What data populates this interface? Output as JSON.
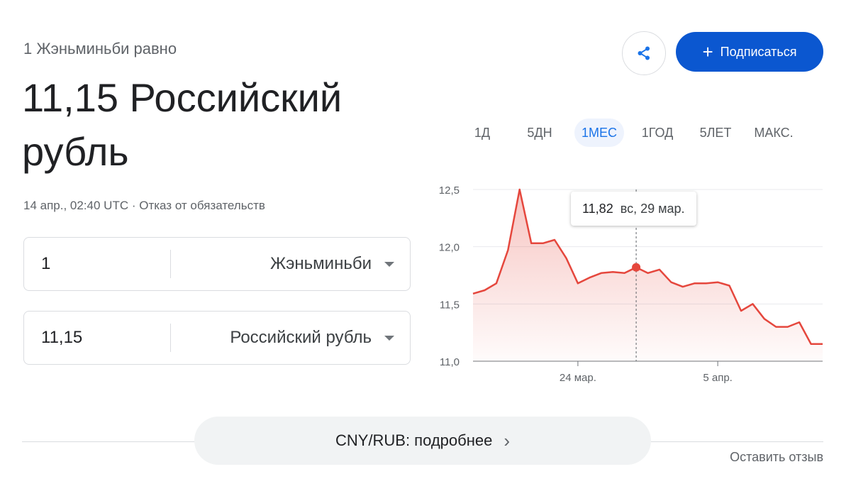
{
  "header": {
    "subtitle": "1 Жэньминьби равно",
    "result": "11,15 Российский рубль",
    "meta": "14 апр., 02:40 UTC · Отказ от обязательств"
  },
  "converter": {
    "from": {
      "amount": "1",
      "currency": "Жэньминьби"
    },
    "to": {
      "amount": "11,15",
      "currency": "Российский рубль"
    }
  },
  "actions": {
    "subscribe_label": "Подписаться",
    "share_icon": "share-icon"
  },
  "ranges": {
    "items": [
      "1Д",
      "5ДН",
      "1МЕС",
      "1ГОД",
      "5ЛЕТ",
      "МАКС."
    ],
    "active": "1МЕС"
  },
  "tooltip": {
    "value": "11,82",
    "date": "вс, 29 мар."
  },
  "footer": {
    "details_label": "CNY/RUB: подробнее",
    "feedback_label": "Оставить отзыв"
  },
  "colors": {
    "line": "#e5473d",
    "accent": "#0b57d0",
    "active_tab": "#1a73e8"
  },
  "chart_data": {
    "type": "area",
    "x": [
      "15 мар.",
      "16 мар.",
      "17 мар.",
      "18 мар.",
      "19 мар.",
      "20 мар.",
      "21 мар.",
      "22 мар.",
      "23 мар.",
      "24 мар.",
      "25 мар.",
      "26 мар.",
      "27 мар.",
      "28 мар.",
      "29 мар.",
      "30 мар.",
      "31 мар.",
      "1 апр.",
      "2 апр.",
      "3 апр.",
      "4 апр.",
      "5 апр.",
      "6 апр.",
      "7 апр.",
      "8 апр.",
      "9 апр.",
      "10 апр.",
      "11 апр.",
      "12 апр.",
      "13 апр.",
      "14 апр."
    ],
    "values": [
      11.59,
      11.62,
      11.68,
      11.97,
      12.5,
      12.03,
      12.03,
      12.06,
      11.9,
      11.68,
      11.73,
      11.77,
      11.78,
      11.77,
      11.82,
      11.77,
      11.8,
      11.69,
      11.65,
      11.68,
      11.68,
      11.69,
      11.66,
      11.44,
      11.5,
      11.37,
      11.3,
      11.3,
      11.34,
      11.15,
      11.15
    ],
    "ylim": [
      11.0,
      12.5
    ],
    "yticks": [
      "12,5",
      "12,0",
      "11,5",
      "11,0"
    ],
    "xtick_labels": [
      {
        "label": "24 мар.",
        "index": 9
      },
      {
        "label": "5 апр.",
        "index": 21
      }
    ],
    "highlight": {
      "index": 14,
      "value": 11.82,
      "label": "11,82",
      "date": "вс, 29 мар."
    },
    "grid": true
  }
}
